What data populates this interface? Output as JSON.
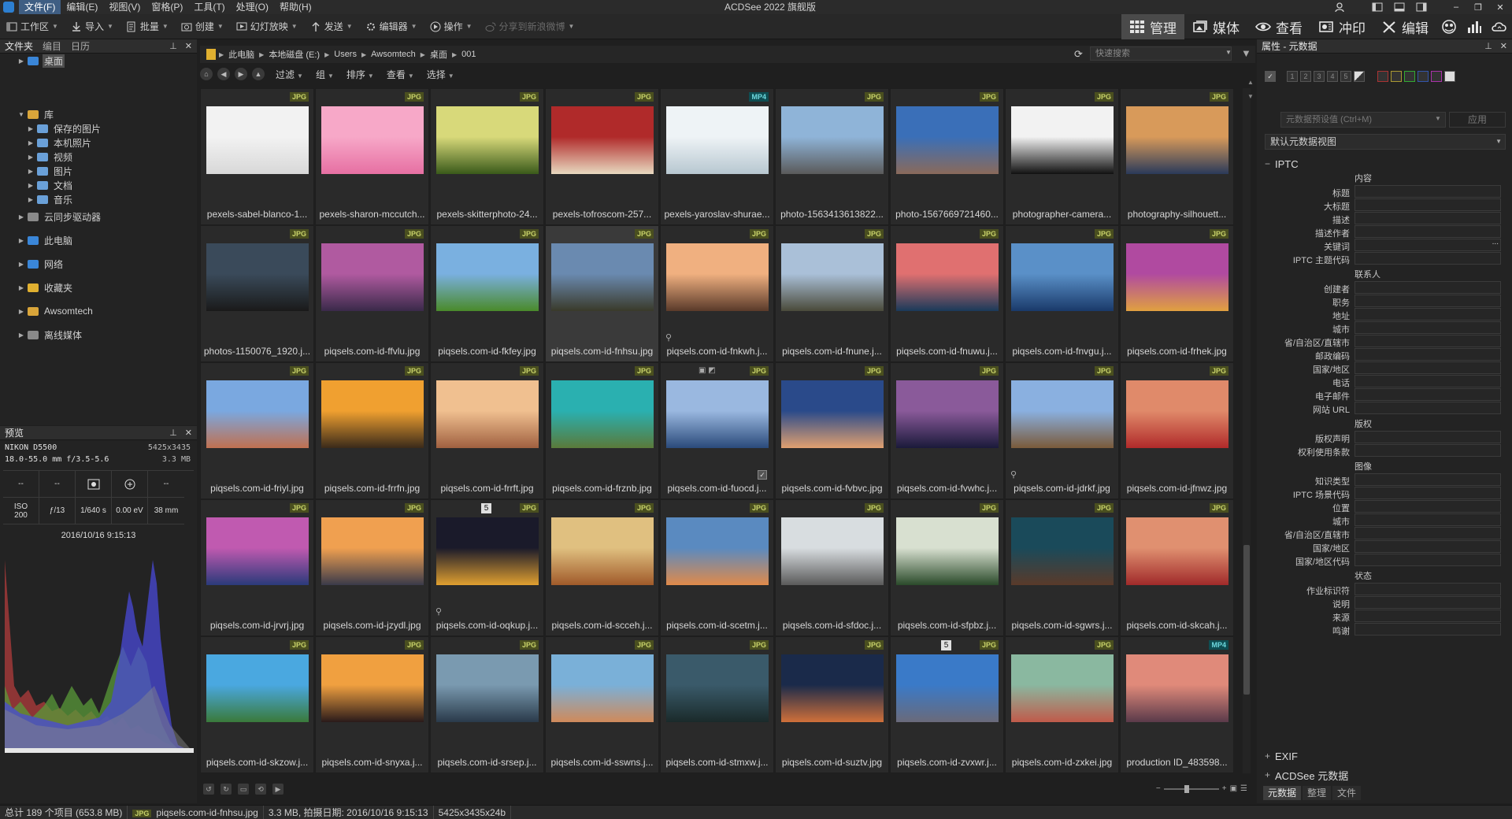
{
  "app": {
    "title": "ACDSee 2022 旗舰版",
    "menu": [
      "文件(F)",
      "编辑(E)",
      "视图(V)",
      "窗格(P)",
      "工具(T)",
      "处理(O)",
      "帮助(H)"
    ]
  },
  "toolbar": {
    "items": [
      {
        "label": "工作区",
        "icon": "workspace-icon"
      },
      {
        "label": "导入",
        "icon": "import-icon"
      },
      {
        "label": "批量",
        "icon": "batch-icon"
      },
      {
        "label": "创建",
        "icon": "create-icon"
      },
      {
        "label": "幻灯放映",
        "icon": "slideshow-icon"
      },
      {
        "label": "发送",
        "icon": "send-icon"
      },
      {
        "label": "编辑器",
        "icon": "editor-icon"
      },
      {
        "label": "操作",
        "icon": "actions-icon"
      },
      {
        "label": "分享到新浪微博",
        "icon": "share-icon"
      }
    ],
    "modes": [
      "管理",
      "媒体",
      "查看",
      "冲印",
      "编辑"
    ]
  },
  "folders": {
    "tabs": [
      "文件夹",
      "编目",
      "日历"
    ],
    "items": [
      {
        "label": "桌面",
        "level": 1,
        "color": "#3a86d8"
      },
      {
        "label": "库",
        "level": 0,
        "color": "#d9a53a"
      },
      {
        "label": "保存的图片",
        "level": 2,
        "color": "#6aa0d8"
      },
      {
        "label": "本机照片",
        "level": 2,
        "color": "#6aa0d8"
      },
      {
        "label": "视频",
        "level": 2,
        "color": "#6aa0d8"
      },
      {
        "label": "图片",
        "level": 2,
        "color": "#6aa0d8"
      },
      {
        "label": "文档",
        "level": 2,
        "color": "#6aa0d8"
      },
      {
        "label": "音乐",
        "level": 2,
        "color": "#6aa0d8"
      },
      {
        "label": "云同步驱动器",
        "level": 0,
        "color": "#8a8a8a"
      },
      {
        "label": "此电脑",
        "level": 0,
        "color": "#3a86d8"
      },
      {
        "label": "网络",
        "level": 0,
        "color": "#3a86d8"
      },
      {
        "label": "收藏夹",
        "level": 0,
        "color": "#e0b030"
      },
      {
        "label": "Awsomtech",
        "level": 0,
        "color": "#d9a53a"
      },
      {
        "label": "离线媒体",
        "level": 0,
        "color": "#8a8a8a"
      }
    ]
  },
  "preview": {
    "title": "预览",
    "camera": "NIKON D5500",
    "dimensions": "5425x3435",
    "lens": "18.0-55.0 mm f/3.5-5.6",
    "size": "3.3 MB",
    "cells": [
      "--",
      "--",
      "",
      "",
      "--",
      "ISO\n200",
      "ƒ/13",
      "1/640 s",
      "0.00 eV",
      "38 mm"
    ],
    "date": "2016/10/16 9:15:13"
  },
  "pathbar": {
    "crumbs": [
      "此电脑",
      "本地磁盘 (E:)",
      "Users",
      "Awsomtech",
      "桌面",
      "001"
    ],
    "search_placeholder": "快速搜索"
  },
  "subbar": {
    "items": [
      "过滤",
      "组",
      "排序",
      "查看",
      "选择"
    ]
  },
  "thumbs": [
    {
      "name": "pexels-sabel-blanco-1...",
      "type": "JPG",
      "c1": "#f2f2f2",
      "c2": "#d8d8d8"
    },
    {
      "name": "pexels-sharon-mccutch...",
      "type": "JPG",
      "c1": "#f7a8c8",
      "c2": "#e66fa2"
    },
    {
      "name": "pexels-skitterphoto-24...",
      "type": "JPG",
      "c1": "#d8d97a",
      "c2": "#3a5a1a"
    },
    {
      "name": "pexels-tofroscom-257...",
      "type": "JPG",
      "c1": "#b02a2a",
      "c2": "#e8d9c0"
    },
    {
      "name": "pexels-yaroslav-shurae...",
      "type": "MP4",
      "c1": "#eef3f6",
      "c2": "#b7c7d0"
    },
    {
      "name": "photo-1563413613822...",
      "type": "JPG",
      "c1": "#8fb4d8",
      "c2": "#5a5a5a"
    },
    {
      "name": "photo-1567669721460...",
      "type": "JPG",
      "c1": "#3a6fb8",
      "c2": "#8a6a5a"
    },
    {
      "name": "photographer-camera...",
      "type": "JPG",
      "c1": "#f2f2f2",
      "c2": "#111111"
    },
    {
      "name": "photography-silhouett...",
      "type": "JPG",
      "c1": "#d89a5a",
      "c2": "#2a3a5a"
    },
    {
      "name": "photos-1150076_1920.j...",
      "type": "JPG",
      "c1": "#3a4a5a",
      "c2": "#1a1a1a"
    },
    {
      "name": "piqsels.com-id-ffvlu.jpg",
      "type": "JPG",
      "c1": "#b05aa0",
      "c2": "#3a2a4a"
    },
    {
      "name": "piqsels.com-id-fkfey.jpg",
      "type": "JPG",
      "c1": "#7ab0e0",
      "c2": "#4a8a2a"
    },
    {
      "name": "piqsels.com-id-fnhsu.jpg",
      "type": "JPG",
      "c1": "#6a8ab0",
      "c2": "#3a3a2a",
      "selected": true
    },
    {
      "name": "piqsels.com-id-fnkwh.j...",
      "type": "JPG",
      "c1": "#f0b080",
      "c2": "#5a3a2a",
      "pin": true
    },
    {
      "name": "piqsels.com-id-fnune.j...",
      "type": "JPG",
      "c1": "#aac0d8",
      "c2": "#4a4a3a"
    },
    {
      "name": "piqsels.com-id-fnuwu.j...",
      "type": "JPG",
      "c1": "#e07070",
      "c2": "#1a3a5a"
    },
    {
      "name": "piqsels.com-id-fnvgu.j...",
      "type": "JPG",
      "c1": "#5a90c8",
      "c2": "#1a3a6a"
    },
    {
      "name": "piqsels.com-id-frhek.jpg",
      "type": "JPG",
      "c1": "#b04aa0",
      "c2": "#e0a040"
    },
    {
      "name": "piqsels.com-id-friyl.jpg",
      "type": "JPG",
      "c1": "#7aa8e0",
      "c2": "#c07050"
    },
    {
      "name": "piqsels.com-id-frrfn.jpg",
      "type": "JPG",
      "c1": "#f0a030",
      "c2": "#3a2a1a"
    },
    {
      "name": "piqsels.com-id-frrft.jpg",
      "type": "JPG",
      "c1": "#f0c090",
      "c2": "#a06040"
    },
    {
      "name": "piqsels.com-id-frznb.jpg",
      "type": "JPG",
      "c1": "#2ab0b0",
      "c2": "#5a7a3a"
    },
    {
      "name": "piqsels.com-id-fuocd.j...",
      "type": "JPG",
      "c1": "#9ab8e0",
      "c2": "#2a4a7a",
      "icons2": true,
      "check": true
    },
    {
      "name": "piqsels.com-id-fvbvc.jpg",
      "type": "JPG",
      "c1": "#2a4a8a",
      "c2": "#e0a070"
    },
    {
      "name": "piqsels.com-id-fvwhc.j...",
      "type": "JPG",
      "c1": "#8a5a9a",
      "c2": "#1a1a3a"
    },
    {
      "name": "piqsels.com-id-jdrkf.jpg",
      "type": "JPG",
      "c1": "#8ab0e0",
      "c2": "#7a5a3a",
      "pin": true
    },
    {
      "name": "piqsels.com-id-jfnwz.jpg",
      "type": "JPG",
      "c1": "#e08a6a",
      "c2": "#b02a2a"
    },
    {
      "name": "piqsels.com-id-jrvrj.jpg",
      "type": "JPG",
      "c1": "#c05ab0",
      "c2": "#2a3a7a"
    },
    {
      "name": "piqsels.com-id-jzydl.jpg",
      "type": "JPG",
      "c1": "#f0a050",
      "c2": "#3a3a4a"
    },
    {
      "name": "piqsels.com-id-oqkup.j...",
      "type": "JPG",
      "c1": "#1a1a2a",
      "c2": "#e0a030",
      "num5": true,
      "pin": true
    },
    {
      "name": "piqsels.com-id-scceh.j...",
      "type": "JPG",
      "c1": "#e0c080",
      "c2": "#a05a2a"
    },
    {
      "name": "piqsels.com-id-scetm.j...",
      "type": "JPG",
      "c1": "#5a8ac0",
      "c2": "#e08a4a"
    },
    {
      "name": "piqsels.com-id-sfdoc.j...",
      "type": "JPG",
      "c1": "#d8dde0",
      "c2": "#5a5a5a"
    },
    {
      "name": "piqsels.com-id-sfpbz.j...",
      "type": "JPG",
      "c1": "#d8e0d0",
      "c2": "#2a4a2a"
    },
    {
      "name": "piqsels.com-id-sgwrs.j...",
      "type": "JPG",
      "c1": "#1a4a5a",
      "c2": "#5a3a2a"
    },
    {
      "name": "piqsels.com-id-skcah.j...",
      "type": "JPG",
      "c1": "#e09070",
      "c2": "#a02a2a"
    },
    {
      "name": "piqsels.com-id-skzow.j...",
      "type": "JPG",
      "c1": "#4aa8e0",
      "c2": "#3a7a3a"
    },
    {
      "name": "piqsels.com-id-snyxa.j...",
      "type": "JPG",
      "c1": "#f0a040",
      "c2": "#2a1a1a"
    },
    {
      "name": "piqsels.com-id-srsep.j...",
      "type": "JPG",
      "c1": "#7a9ab0",
      "c2": "#2a3a4a"
    },
    {
      "name": "piqsels.com-id-sswns.j...",
      "type": "JPG",
      "c1": "#7ab0d8",
      "c2": "#d08a5a"
    },
    {
      "name": "piqsels.com-id-stmxw.j...",
      "type": "JPG",
      "c1": "#3a5a6a",
      "c2": "#1a2a2a"
    },
    {
      "name": "piqsels.com-id-suztv.jpg",
      "type": "JPG",
      "c1": "#1a2a4a",
      "c2": "#d0703a"
    },
    {
      "name": "piqsels.com-id-zvxwr.j...",
      "type": "JPG",
      "c1": "#3a7ac8",
      "c2": "#6a6a7a",
      "num5": true
    },
    {
      "name": "piqsels.com-id-zxkei.jpg",
      "type": "JPG",
      "c1": "#8ab8a0",
      "c2": "#c05a4a"
    },
    {
      "name": "production ID_483598...",
      "type": "MP4",
      "c1": "#e08a7a",
      "c2": "#5a3a4a"
    }
  ],
  "props": {
    "title": "属性 - 元数据",
    "rating_numbers": [
      "1",
      "2",
      "3",
      "4",
      "5"
    ],
    "preset_placeholder": "元数据预设值 (Ctrl+M)",
    "apply": "应用",
    "view": "默认元数据视图",
    "iptc": "IPTC",
    "exif": "EXIF",
    "acdsee_meta": "ACDSee 元数据",
    "groups": [
      {
        "label": "内容",
        "fields": [
          "标题",
          "大标题",
          "描述",
          "描述作者",
          "关键词",
          "IPTC 主题代码"
        ]
      },
      {
        "label": "联系人",
        "fields": [
          "创建者",
          "职务",
          "地址",
          "城市",
          "省/自治区/直辖市",
          "邮政编码",
          "国家/地区",
          "电话",
          "电子邮件",
          "网站 URL"
        ]
      },
      {
        "label": "版权",
        "fields": [
          "版权声明",
          "权利使用条款"
        ]
      },
      {
        "label": "图像",
        "fields": [
          "知识类型",
          "IPTC 场景代码",
          "位置",
          "城市",
          "省/自治区/直辖市",
          "国家/地区",
          "国家/地区代码"
        ]
      },
      {
        "label": "状态",
        "fields": [
          "作业标识符",
          "说明",
          "来源",
          "鸣谢"
        ]
      }
    ],
    "tabs": [
      "元数据",
      "整理",
      "文件"
    ]
  },
  "status": {
    "total": "总计 189 个项目 (653.8 MB)",
    "badge": "JPG",
    "selected_file": "piqsels.com-id-fnhsu.jpg",
    "info": "3.3 MB, 拍摄日期: 2016/10/16 9:15:13",
    "dims": "5425x3435x24b"
  }
}
